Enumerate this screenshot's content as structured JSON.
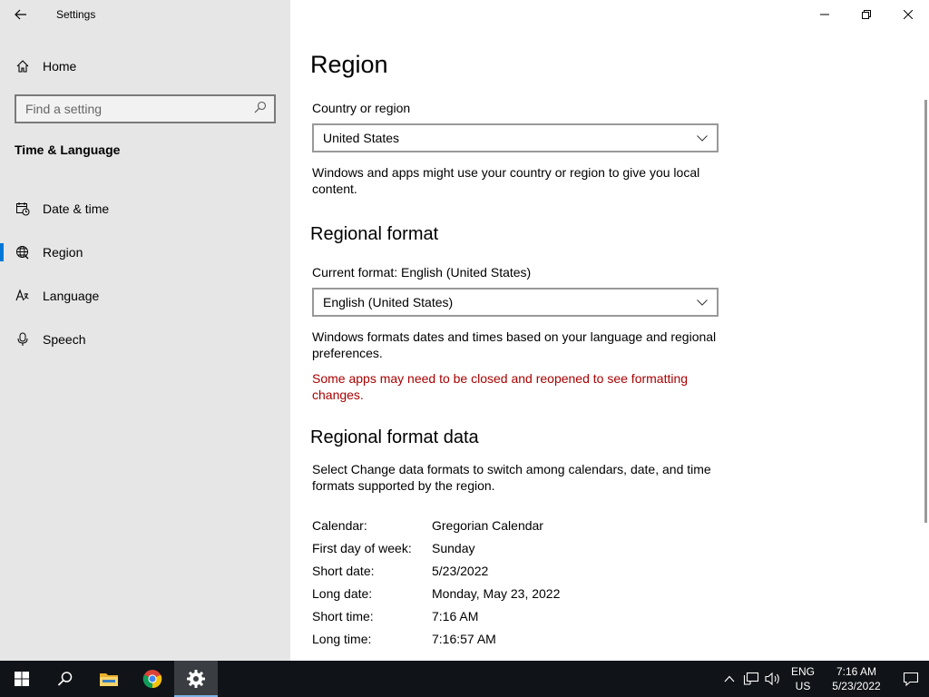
{
  "window": {
    "title": "Settings"
  },
  "sidebar": {
    "home_label": "Home",
    "search_placeholder": "Find a setting",
    "section_title": "Time & Language",
    "items": [
      {
        "label": "Date & time",
        "icon": "calendar-clock-icon"
      },
      {
        "label": "Region",
        "icon": "globe-icon",
        "selected": true
      },
      {
        "label": "Language",
        "icon": "language-icon"
      },
      {
        "label": "Speech",
        "icon": "microphone-icon"
      }
    ]
  },
  "main": {
    "title": "Region",
    "country_label": "Country or region",
    "country_value": "United States",
    "country_desc": "Windows and apps might use your country or region to give you local content.",
    "regional_format_title": "Regional format",
    "current_format_label": "Current format: English (United States)",
    "format_value": "English (United States)",
    "format_desc": "Windows formats dates and times based on your language and regional preferences.",
    "format_warning": "Some apps may need to be closed and reopened to see formatting changes.",
    "format_data_title": "Regional format data",
    "format_data_desc": "Select Change data formats to switch among calendars, date, and time formats supported by the region.",
    "format_data": [
      {
        "key": "Calendar:",
        "value": "Gregorian Calendar"
      },
      {
        "key": "First day of week:",
        "value": "Sunday"
      },
      {
        "key": "Short date:",
        "value": "5/23/2022"
      },
      {
        "key": "Long date:",
        "value": "Monday, May 23, 2022"
      },
      {
        "key": "Short time:",
        "value": "7:16 AM"
      },
      {
        "key": "Long time:",
        "value": "7:16:57 AM"
      }
    ]
  },
  "taskbar": {
    "lang_line1": "ENG",
    "lang_line2": "US",
    "time": "7:16 AM",
    "date": "5/23/2022"
  },
  "colors": {
    "accent": "#0078d7",
    "warning": "#a80000",
    "sidebar_bg": "#e6e6e6",
    "taskbar_bg": "#101317"
  }
}
